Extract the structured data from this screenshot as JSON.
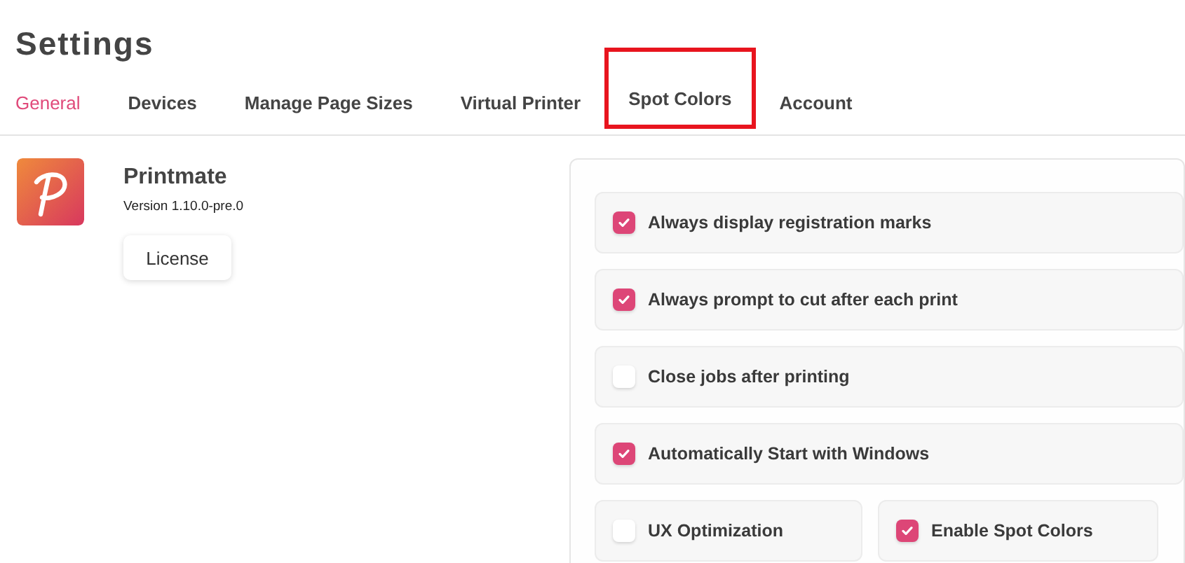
{
  "title": "Settings",
  "tabs": [
    {
      "label": "General",
      "selected": true,
      "highlighted": false
    },
    {
      "label": "Devices",
      "selected": false,
      "highlighted": false
    },
    {
      "label": "Manage Page Sizes",
      "selected": false,
      "highlighted": false
    },
    {
      "label": "Virtual Printer",
      "selected": false,
      "highlighted": false
    },
    {
      "label": "Spot Colors",
      "selected": false,
      "highlighted": true
    },
    {
      "label": "Account",
      "selected": false,
      "highlighted": false
    }
  ],
  "app": {
    "name": "Printmate",
    "version": "Version 1.10.0-pre.0",
    "license_button": "License"
  },
  "options": [
    {
      "label": "Always display registration marks",
      "checked": true
    },
    {
      "label": "Always prompt to cut after each print",
      "checked": true
    },
    {
      "label": "Close jobs after printing",
      "checked": false
    },
    {
      "label": "Automatically Start with Windows",
      "checked": true
    }
  ],
  "paired_options": [
    {
      "label": "UX Optimization",
      "checked": false
    },
    {
      "label": "Enable Spot Colors",
      "checked": true
    }
  ]
}
